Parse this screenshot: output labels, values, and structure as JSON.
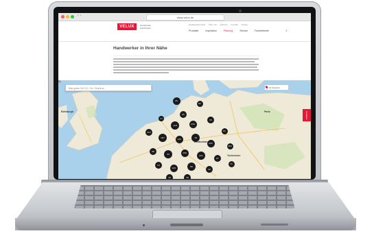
{
  "browser": {
    "url": "www.velux.de",
    "back": "‹",
    "forward": "›"
  },
  "site": {
    "logo": "VELUX",
    "logo_sub": [
      "Handwerker",
      "Fachhandel"
    ],
    "top_nav": [
      "Handwerkerportal",
      "Über uns",
      "Karriere",
      "Kontakt",
      "Presse"
    ],
    "main_nav": [
      "Produkte",
      "Inspiration",
      "Planung",
      "Service",
      "Fachbetriebe"
    ],
    "active_nav_index": 2,
    "page_title": "Handwerker in Ihrer Nähe"
  },
  "map": {
    "search_placeholder": "Bitte geben Sie PLZ / Ort / Straße an",
    "locate_label": "Ihr Standort",
    "labels": {
      "edinburgh": "Edinburgh",
      "paris": "Paris",
      "deutschland": "Deutschland",
      "tschechien": "Tschechien"
    },
    "clusters": [
      {
        "label": "25"
      },
      {
        "label": "82"
      },
      {
        "label": "45"
      },
      {
        "label": "17"
      },
      {
        "label": "118"
      },
      {
        "label": "234"
      },
      {
        "label": "95"
      },
      {
        "label": "61"
      },
      {
        "label": "312"
      },
      {
        "label": "187"
      },
      {
        "label": "140"
      },
      {
        "label": "76"
      },
      {
        "label": "205"
      },
      {
        "label": "263"
      },
      {
        "label": "98"
      },
      {
        "label": "33"
      },
      {
        "label": "156"
      },
      {
        "label": "221"
      },
      {
        "label": "87"
      },
      {
        "label": "54"
      },
      {
        "label": "129"
      },
      {
        "label": "66"
      },
      {
        "label": "42"
      },
      {
        "label": "71"
      },
      {
        "label": "39"
      },
      {
        "label": "58"
      }
    ]
  },
  "feedback_tab": "Feedback",
  "colors": {
    "brand": "#e31937",
    "water": "#a9d1ec",
    "land": "#efe9d8",
    "cluster": "#1b1b1b"
  }
}
